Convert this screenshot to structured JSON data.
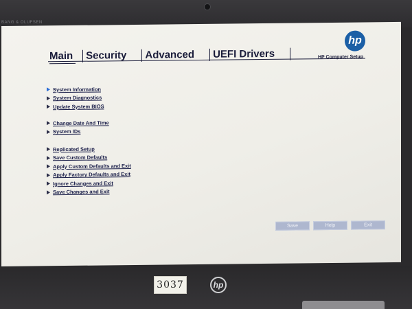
{
  "bezel": {
    "brand_text": "BANG & OLUFSEN",
    "sticker_text": "3037",
    "bottom_logo": "hp"
  },
  "header": {
    "logo_text": "hp",
    "subtitle": "HP Computer Setup",
    "tabs": [
      {
        "label": "Main"
      },
      {
        "label": "Security"
      },
      {
        "label": "Advanced"
      },
      {
        "label": "UEFI Drivers"
      }
    ]
  },
  "menu": {
    "group1": [
      {
        "label": "System Information",
        "selected": true
      },
      {
        "label": "System Diagnostics"
      },
      {
        "label": "Update System BIOS"
      }
    ],
    "group2": [
      {
        "label": "Change Date And Time"
      },
      {
        "label": "System IDs"
      }
    ],
    "group3": [
      {
        "label": "Replicated Setup"
      },
      {
        "label": "Save Custom Defaults"
      },
      {
        "label": "Apply Custom Defaults and Exit"
      },
      {
        "label": "Apply Factory Defaults and Exit"
      },
      {
        "label": "Ignore Changes and Exit"
      },
      {
        "label": "Save Changes and Exit"
      }
    ]
  },
  "buttons": {
    "save": "Save",
    "help": "Help",
    "exit": "Exit"
  },
  "colors": {
    "accent": "#1b5fa6",
    "text": "#1b1f4a",
    "button_bg": "#aeb7cf"
  }
}
